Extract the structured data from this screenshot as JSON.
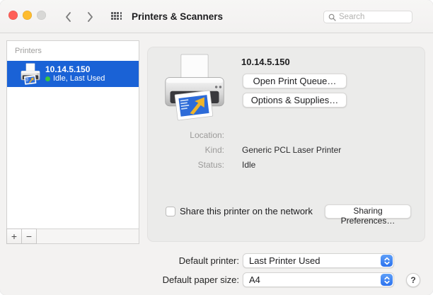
{
  "window": {
    "title": "Printers & Scanners",
    "search_placeholder": "Search"
  },
  "sidebar": {
    "header": "Printers",
    "printers": [
      {
        "name": "10.14.5.150",
        "status": "Idle, Last Used",
        "selected": true
      }
    ],
    "add_label": "+",
    "remove_label": "−"
  },
  "main": {
    "printer_name": "10.14.5.150",
    "open_queue_label": "Open Print Queue…",
    "options_supplies_label": "Options & Supplies…",
    "info": [
      {
        "label": "Location:",
        "value": ""
      },
      {
        "label": "Kind:",
        "value": "Generic PCL Laser Printer"
      },
      {
        "label": "Status:",
        "value": "Idle"
      }
    ],
    "share": {
      "label": "Share this printer on the network",
      "checked": false,
      "button_label": "Sharing Preferences…"
    }
  },
  "footer": {
    "default_printer": {
      "label": "Default printer:",
      "value": "Last Printer Used"
    },
    "default_paper": {
      "label": "Default paper size:",
      "value": "A4"
    },
    "help_label": "?"
  },
  "colors": {
    "selection_blue": "#1a62d6",
    "accent_blue": "#2c72ee",
    "status_green": "#38c53f",
    "traffic_red": "#ff5f57",
    "traffic_yellow": "#febc2e",
    "traffic_disabled": "#d8d8d6",
    "panel_gray": "#ebebea"
  }
}
